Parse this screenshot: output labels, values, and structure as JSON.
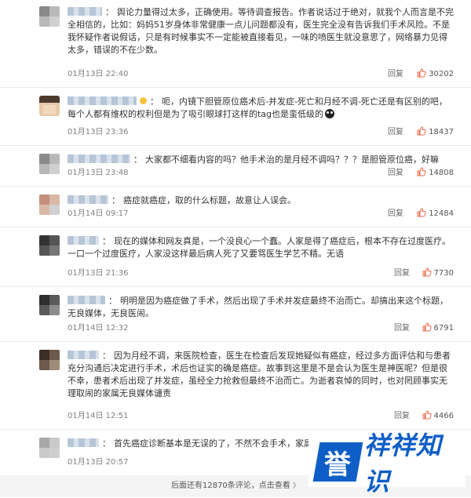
{
  "colors": {
    "like_icon": "#ee6a4a",
    "watermark_blue": "#0f5ec7",
    "footer_bg": "#f4f4f4"
  },
  "comments": [
    {
      "text": "舆论力量得过太多，正确使用。等待调查报告。作者说话过于绝对，就我个人而言是不完全相信的，比如：妈妈51岁身体非常健康一点儿问题都没有，医生完全没有告诉我们手术风险。不是我怀疑作者说假话，只是有时候事实不一定能被直接看见，一味的喷医生就没意思了，网络暴力见得太多，错误的不在少数。",
      "time": "01月13日 22:40",
      "reply": "回复",
      "likes": "30202"
    },
    {
      "text": "呃，内镜下胆管原位癌术后-并发症-死亡和月经不调-死亡还是有区别的吧，每个人都有维权的权利但是为了吸引眼球打这样的tag也是蛮低级的",
      "time": "01月13日 23:36",
      "reply": "回复",
      "likes": "18437"
    },
    {
      "text": "大家都不细看内容的吗？他手术治的是月经不调吗？？？是胆管原位癌，好嘛",
      "time": "01月13日 23:48",
      "reply": "回复",
      "likes": "14808"
    },
    {
      "text": "癌症就癌症，取的什么标题，故意让人误会。",
      "time": "01月14日 09:17",
      "reply": "回复",
      "likes": "12484"
    },
    {
      "text": "现在的媒体和网友真是，一个没良心一个蠢。人家是得了癌症后，根本不存在过度医疗。一口一个过度医疗，人家没这样最后病人死了又要骂医生学艺不精。无语",
      "time": "01月13日 21:36",
      "reply": "回复",
      "likes": "7730"
    },
    {
      "text": "明明是因为癌症做了手术，然后出现了手术并发症最终不治而亡。却搞出来这个标题，无良媒体，无良医闹。",
      "time": "01月14日 12:32",
      "reply": "回复",
      "likes": "6791"
    },
    {
      "text": "因为月经不调，来医院检查，医生在检查后发现她疑似有癌症，经过多方面评估和与患者充分沟通后决定进行手术，术后也证实的确是癌症。故事到这里是不是会认为医生是神医呢？但是很不幸，患者术后出现了并发症，虽经全力抢救但最终不治而亡。为逝者哀悼的同时，也对罔顾事实无理取闹的家属无良媒体谴责",
      "time": "01月14日 12:51",
      "reply": "回复",
      "likes": "4466"
    },
    {
      "text": "首先癌症诊断基本是无误的了，不然不会手术，家属肯定",
      "time": "01月13日 20:57",
      "reply": "",
      "likes": ""
    }
  ],
  "footer": {
    "text": "后面还有12870条评论，点击查看",
    "chevron": "〉"
  },
  "watermark": {
    "logo_char": "誉",
    "rest": "祥祥知识"
  }
}
